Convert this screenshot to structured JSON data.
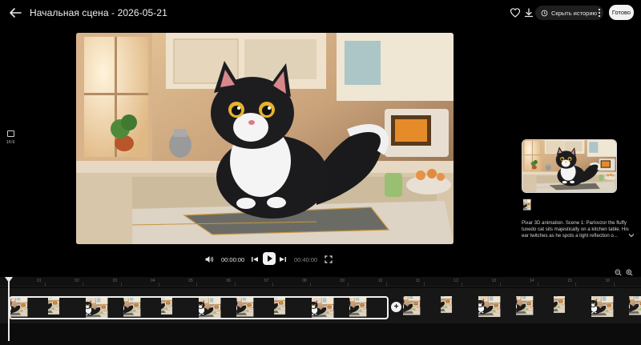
{
  "header": {
    "title": "Начальная сцена - 2026-05-21",
    "hide_history_label": "Скрыть историю",
    "done_label": "Готово",
    "icons": [
      "back-arrow-icon",
      "heart-icon",
      "download-icon",
      "history-icon",
      "more-vert-icon"
    ]
  },
  "aspect": {
    "label": "16:9"
  },
  "side_panel": {
    "prompt_text": "Pixar 3D animation. Scene 1: Parlovzor the fluffy tuxedo cat sits majestically on a kitchen table. His ear twitches as he spots a light reflection o..."
  },
  "player": {
    "current_time": "00:00:00",
    "total_time": "00:40:00",
    "icons": [
      "volume-icon",
      "skip-previous-icon",
      "play-icon",
      "skip-next-icon",
      "fullscreen-icon"
    ]
  },
  "timeline": {
    "ticks": [
      "01",
      "02",
      "03",
      "04",
      "05",
      "06",
      "07",
      "08",
      "09",
      "10",
      "11",
      "12",
      "13",
      "14",
      "15",
      "16"
    ],
    "add_label": "+"
  },
  "colors": {
    "background": "#000000",
    "accent_light": "#f2f2f2",
    "pill_bg": "#1f1f1f"
  }
}
